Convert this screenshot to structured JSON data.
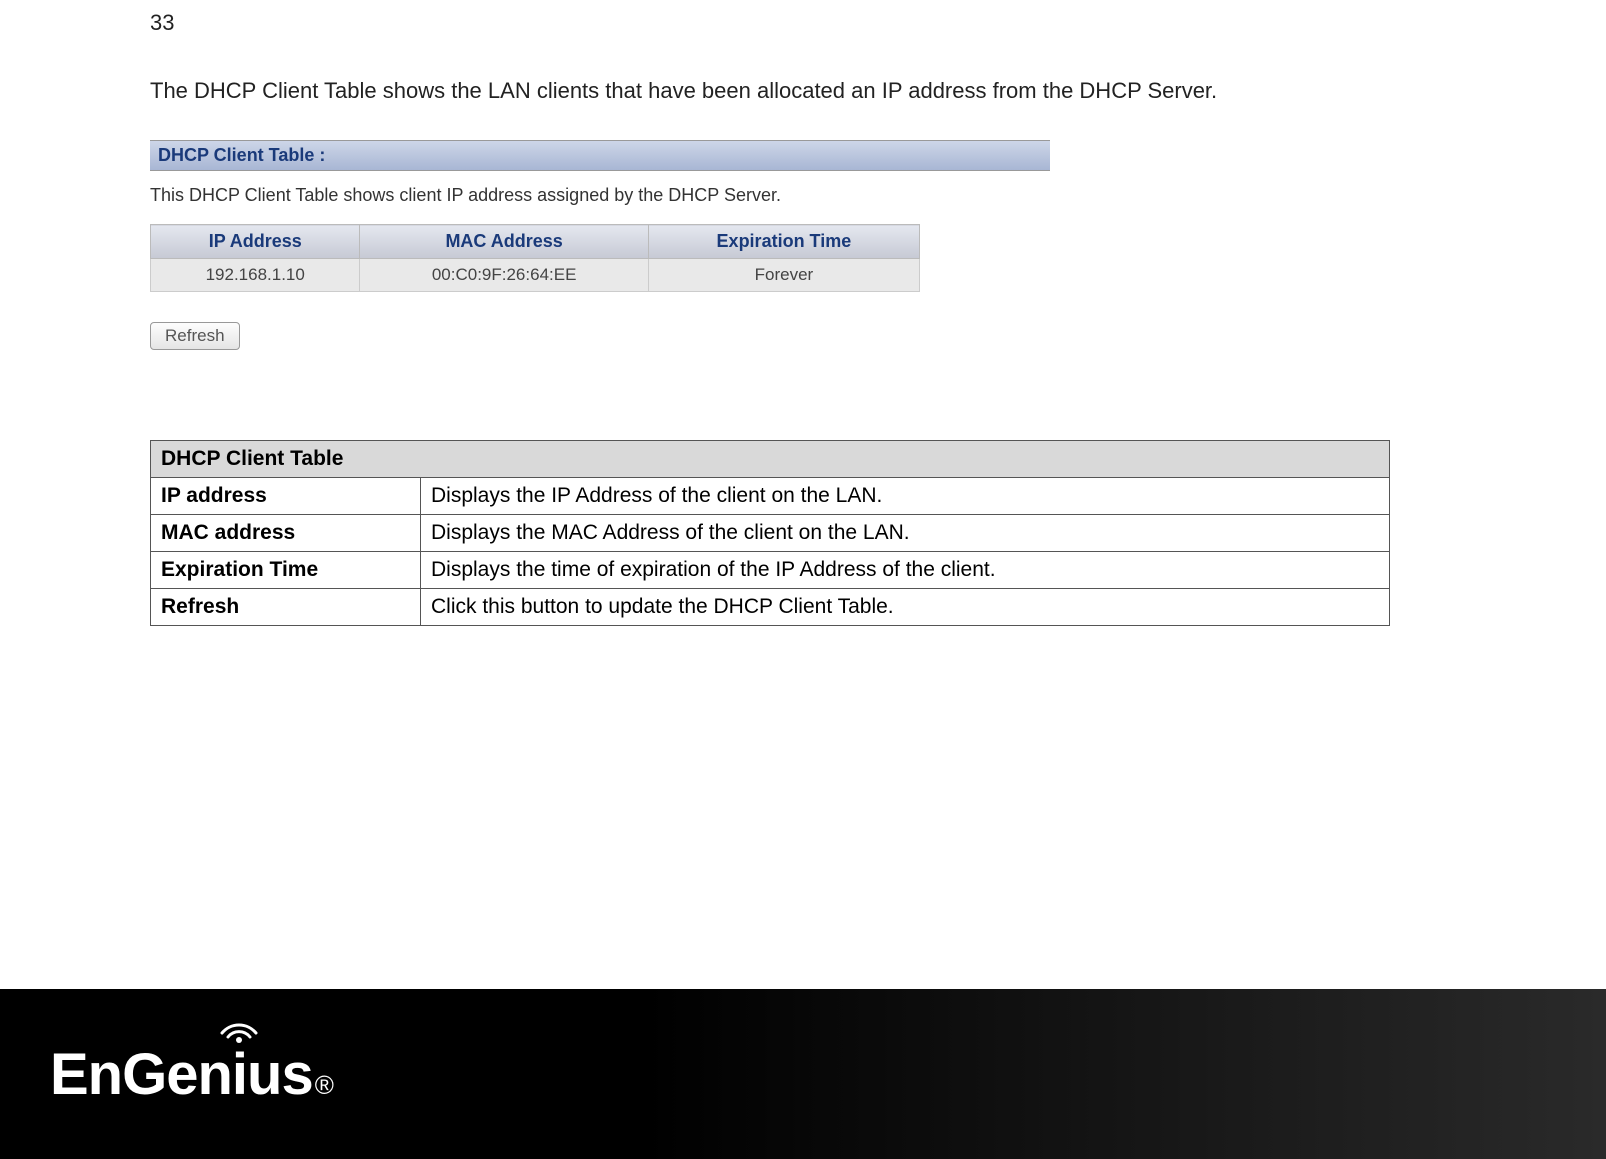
{
  "page_number": "33",
  "intro": "The DHCP Client Table shows the LAN clients that have been allocated an IP address from the DHCP Server.",
  "screenshot": {
    "header": "DHCP Client Table :",
    "description": "This DHCP Client Table shows client IP address assigned by the DHCP Server.",
    "columns": {
      "ip": "IP Address",
      "mac": "MAC Address",
      "exp": "Expiration Time"
    },
    "row": {
      "ip": "192.168.1.10",
      "mac": "00:C0:9F:26:64:EE",
      "exp": "Forever"
    },
    "refresh_label": "Refresh"
  },
  "doc_table": {
    "title": "DHCP Client Table",
    "rows": {
      "r1_label": "IP address",
      "r1_desc": "Displays the IP Address of the client on the LAN.",
      "r2_label": "MAC address",
      "r2_desc": "Displays the MAC Address of the client on the LAN.",
      "r3_label": "Expiration Time",
      "r3_desc": "Displays the time of expiration of the IP Address of the client.",
      "r4_label": "Refresh",
      "r4_desc": "Click this button to update the DHCP Client Table."
    }
  },
  "logo": {
    "brand": "EnGenius",
    "reg": "®"
  }
}
